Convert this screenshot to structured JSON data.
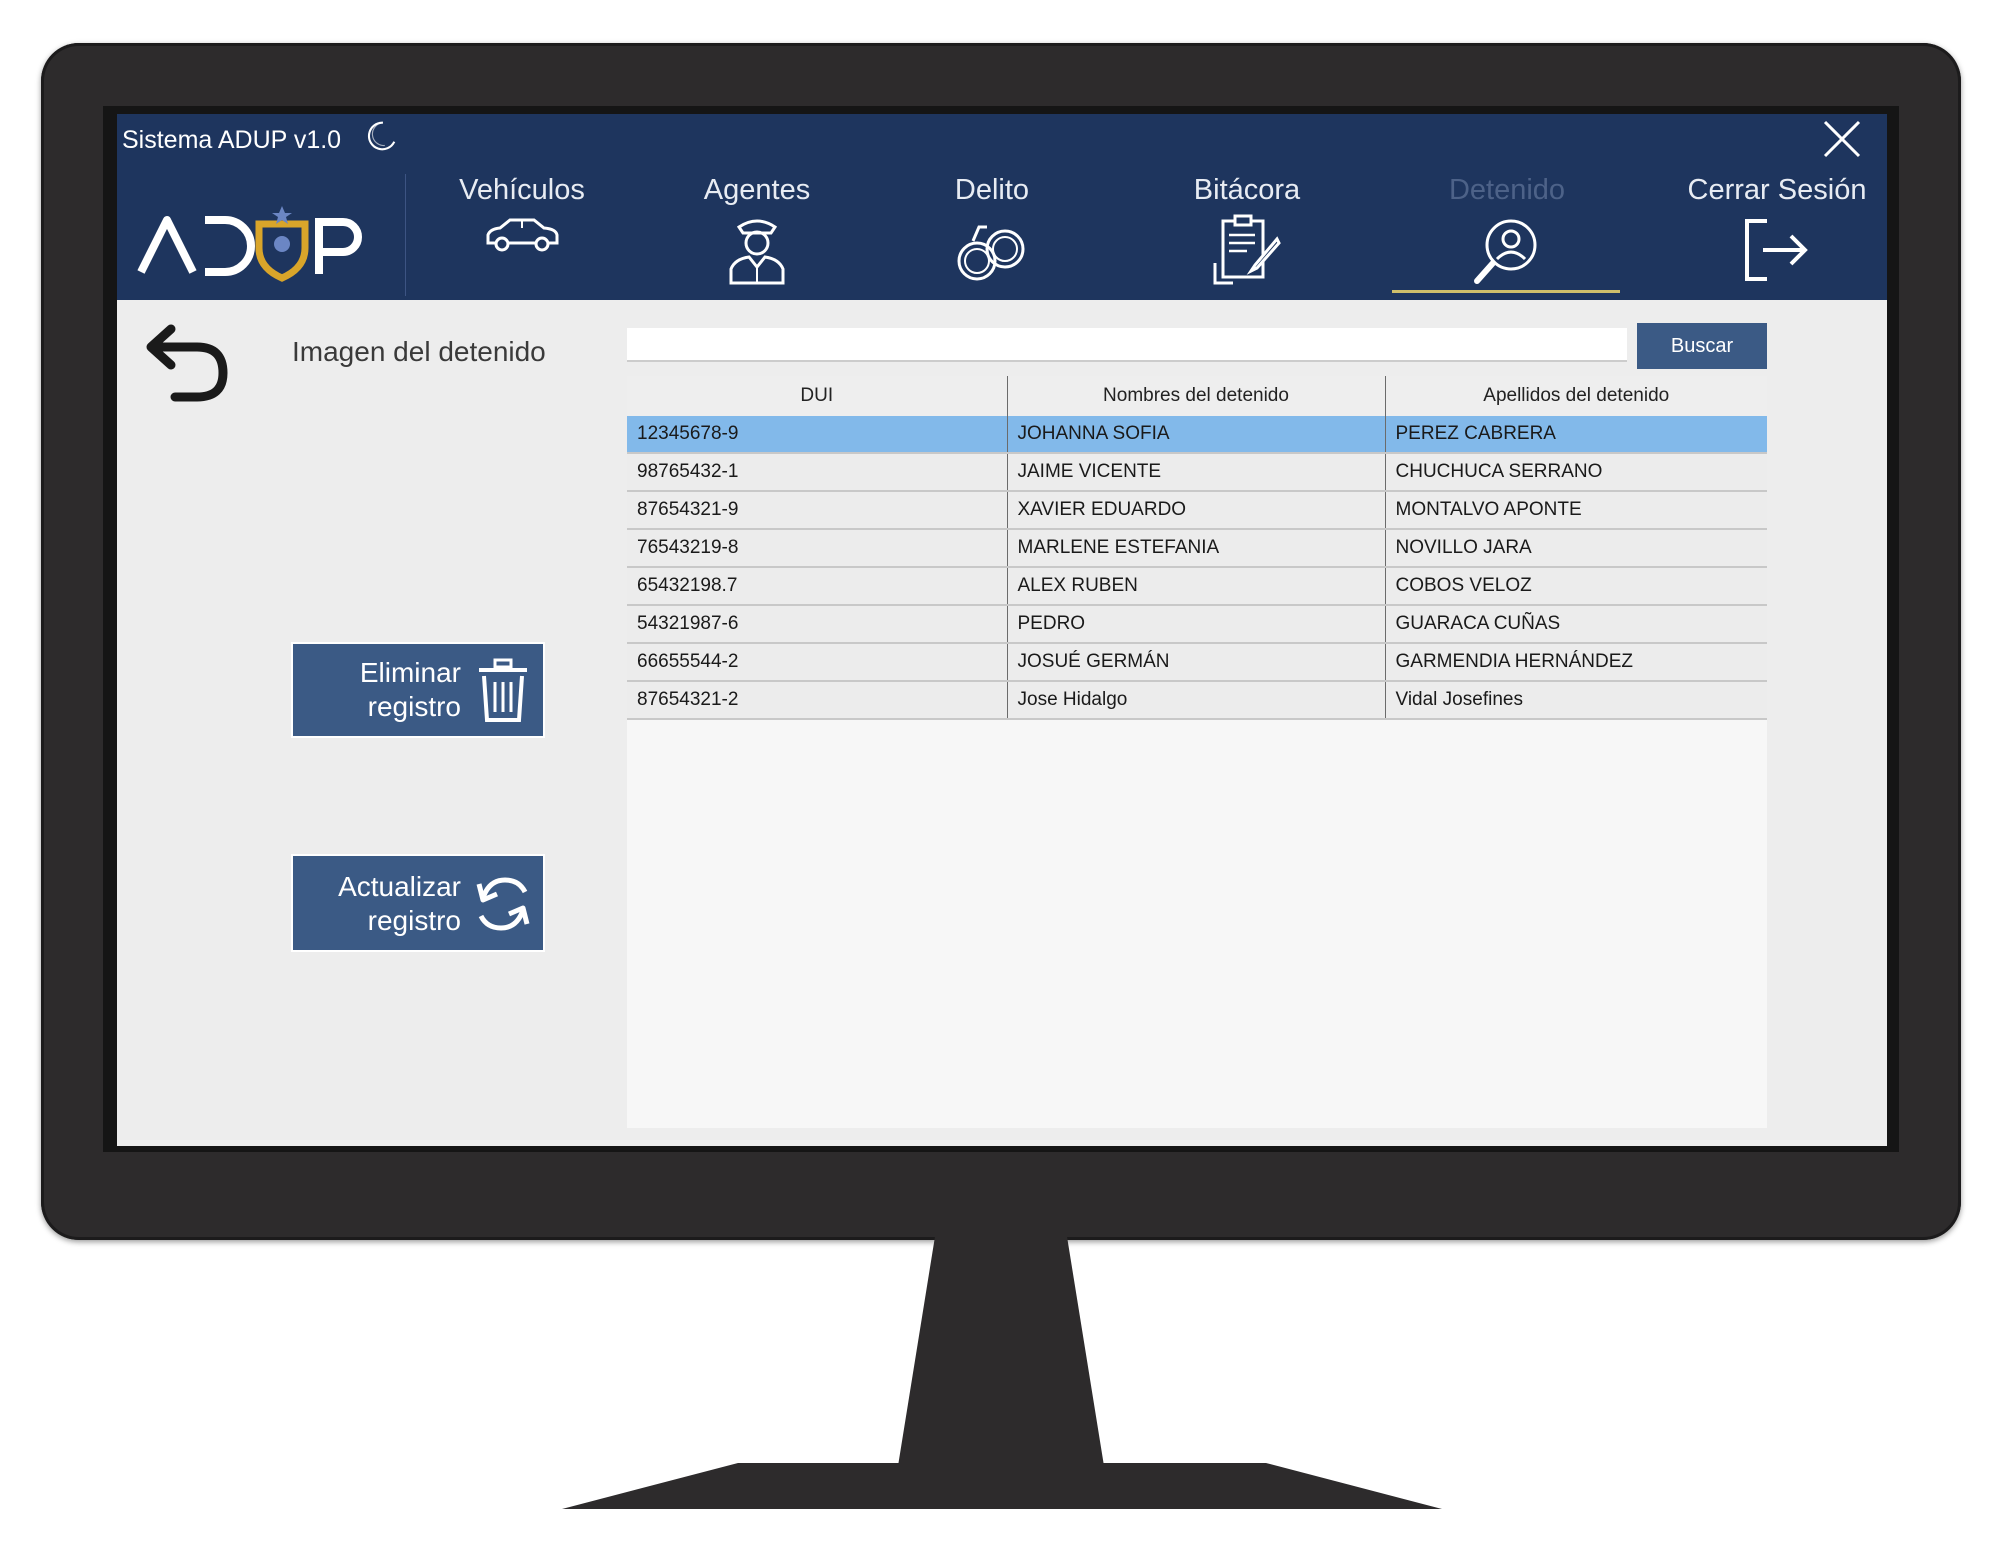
{
  "app": {
    "title": "Sistema ADUP v1.0",
    "logo_text": "ADUP"
  },
  "nav": {
    "vehiculos": "Vehículos",
    "agentes": "Agentes",
    "delito": "Delito",
    "bitacora": "Bitácora",
    "detenido": "Detenido",
    "cerrar_sesion": "Cerrar Sesión",
    "active": "Detenido"
  },
  "panel": {
    "image_label": "Imagen del detenido",
    "delete_line1": "Eliminar",
    "delete_line2": "registro",
    "update_line1": "Actualizar",
    "update_line2": "registro"
  },
  "search": {
    "value": "",
    "button": "Buscar"
  },
  "table": {
    "headers": [
      "DUI",
      "Nombres del detenido",
      "Apellidos del detenido"
    ],
    "selected_row": 0,
    "rows": [
      {
        "dui": "12345678-9",
        "nombres": "JOHANNA SOFIA",
        "apellidos": "PEREZ CABRERA"
      },
      {
        "dui": "98765432-1",
        "nombres": "JAIME VICENTE",
        "apellidos": "CHUCHUCA SERRANO"
      },
      {
        "dui": "87654321-9",
        "nombres": "XAVIER EDUARDO",
        "apellidos": "MONTALVO APONTE"
      },
      {
        "dui": "76543219-8",
        "nombres": "MARLENE ESTEFANIA",
        "apellidos": "NOVILLO JARA"
      },
      {
        "dui": "65432198.7",
        "nombres": "ALEX RUBEN",
        "apellidos": "COBOS VELOZ"
      },
      {
        "dui": "54321987-6",
        "nombres": "PEDRO",
        "apellidos": "GUARACA CUÑAS"
      },
      {
        "dui": "66655544-2",
        "nombres": "JOSUÉ GERMÁN",
        "apellidos": "GARMENDIA HERNÁNDEZ"
      },
      {
        "dui": "87654321-2",
        "nombres": "Jose Hidalgo",
        "apellidos": "Vidal Josefines"
      }
    ]
  },
  "colors": {
    "header_bg": "#1e355e",
    "button_bg": "#3b5a85",
    "selected_row": "#82b9ea",
    "active_underline": "#cfbf6b",
    "logo_accent": "#d9a52a"
  }
}
